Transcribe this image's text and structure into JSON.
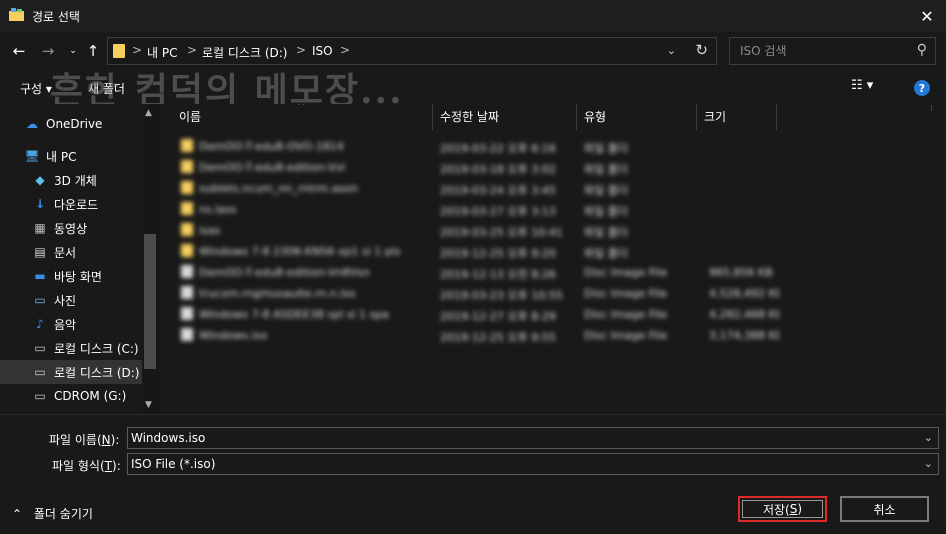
{
  "window": {
    "title": "경로 선택",
    "close_icon": "close-icon"
  },
  "address": {
    "crumbs": [
      "내 PC",
      "로컬 디스크 (D:)",
      "ISO"
    ],
    "separator": ">"
  },
  "search": {
    "placeholder": "ISO 검색"
  },
  "toolbar": {
    "organize": "구성 ▾",
    "new_folder": "새 폴더",
    "help": "?"
  },
  "watermark": "흔한 컴덕의 메모장...",
  "sidebar": {
    "items": [
      {
        "label": "OneDrive",
        "icon": "cloud-icon",
        "color": "#3a8ee6"
      },
      {
        "label": "내 PC",
        "icon": "computer-icon",
        "color": "#4aa3df"
      },
      {
        "label": "3D 개체",
        "icon": "cube-icon",
        "color": "#5bc0eb"
      },
      {
        "label": "다운로드",
        "icon": "download-icon",
        "color": "#3a8ee6"
      },
      {
        "label": "동영상",
        "icon": "video-icon",
        "color": "#bbbbbb"
      },
      {
        "label": "문서",
        "icon": "document-icon",
        "color": "#dddddd"
      },
      {
        "label": "바탕 화면",
        "icon": "desktop-icon",
        "color": "#3a8ee6"
      },
      {
        "label": "사진",
        "icon": "picture-icon",
        "color": "#88b8e0"
      },
      {
        "label": "음악",
        "icon": "music-icon",
        "color": "#3a8ee6"
      },
      {
        "label": "로컬 디스크 (C:)",
        "icon": "drive-icon",
        "color": "#cccccc"
      },
      {
        "label": "로컬 디스크 (D:)",
        "icon": "drive-icon",
        "color": "#cccccc"
      },
      {
        "label": "CDROM (G:)",
        "icon": "cdrom-icon",
        "color": "#cccccc"
      }
    ]
  },
  "columns": [
    "이름",
    "수정한 날짜",
    "유형",
    "크기"
  ],
  "files": [
    {
      "type": "folder",
      "name": "DemOO-T-edu8-OVO-1814",
      "date": "2019-03-22 오후 6:16",
      "kind": "파일 폴더",
      "size": ""
    },
    {
      "type": "folder",
      "name": "DemOO-T-edu8-edition-Vvl",
      "date": "2019-03-18 오후 3:02",
      "kind": "파일 폴더",
      "size": ""
    },
    {
      "type": "folder",
      "name": "sublets.ncum_nn_rntrm.ason",
      "date": "2019-03-24 오후 3:45",
      "kind": "파일 폴더",
      "size": ""
    },
    {
      "type": "folder",
      "name": "ns.lass",
      "date": "2019-03-27 오후 3:13",
      "kind": "파일 폴더",
      "size": ""
    },
    {
      "type": "folder",
      "name": "lsas",
      "date": "2019-03-25 오후 10:41",
      "kind": "파일 폴더",
      "size": ""
    },
    {
      "type": "folder",
      "name": "Windows 7-8 2306-KNS6 xp1 sl 1 pls",
      "date": "2019-12-25 오후 9:20",
      "kind": "파일 폴더",
      "size": ""
    },
    {
      "type": "file",
      "name": "DemOO-T-edu8-edition-Vn8Vsn",
      "date": "2019-12-13 오전 8:26",
      "kind": "Disc Image File",
      "size": "965,856 KB"
    },
    {
      "type": "file",
      "name": "trucom.rngmusauite.rn.n.iso",
      "date": "2019-03-23 오후 10:55",
      "kind": "Disc Image File",
      "size": "4,528,492 KB"
    },
    {
      "type": "file",
      "name": "Windows 7-8 ASDEE38 spl sl 1 spa",
      "date": "2019-12-27 오후 8:29",
      "kind": "Disc Image File",
      "size": "4,282,468 KB"
    },
    {
      "type": "file",
      "name": "Windows.iso",
      "date": "2019-12-25 오후 9:55",
      "kind": "Disc Image File",
      "size": "3,174,388 KB"
    }
  ],
  "filename": {
    "label": "파일 이름(",
    "accel": "N",
    "suffix": "):",
    "value": "Windows.iso"
  },
  "filetype": {
    "label": "파일 형식(",
    "accel": "T",
    "suffix": "):",
    "value": "ISO File (*.iso)"
  },
  "hide_folders": "폴더 숨기기",
  "buttons": {
    "save": {
      "text": "저장(",
      "accel": "S",
      "suffix": ")"
    },
    "cancel": "취소"
  }
}
